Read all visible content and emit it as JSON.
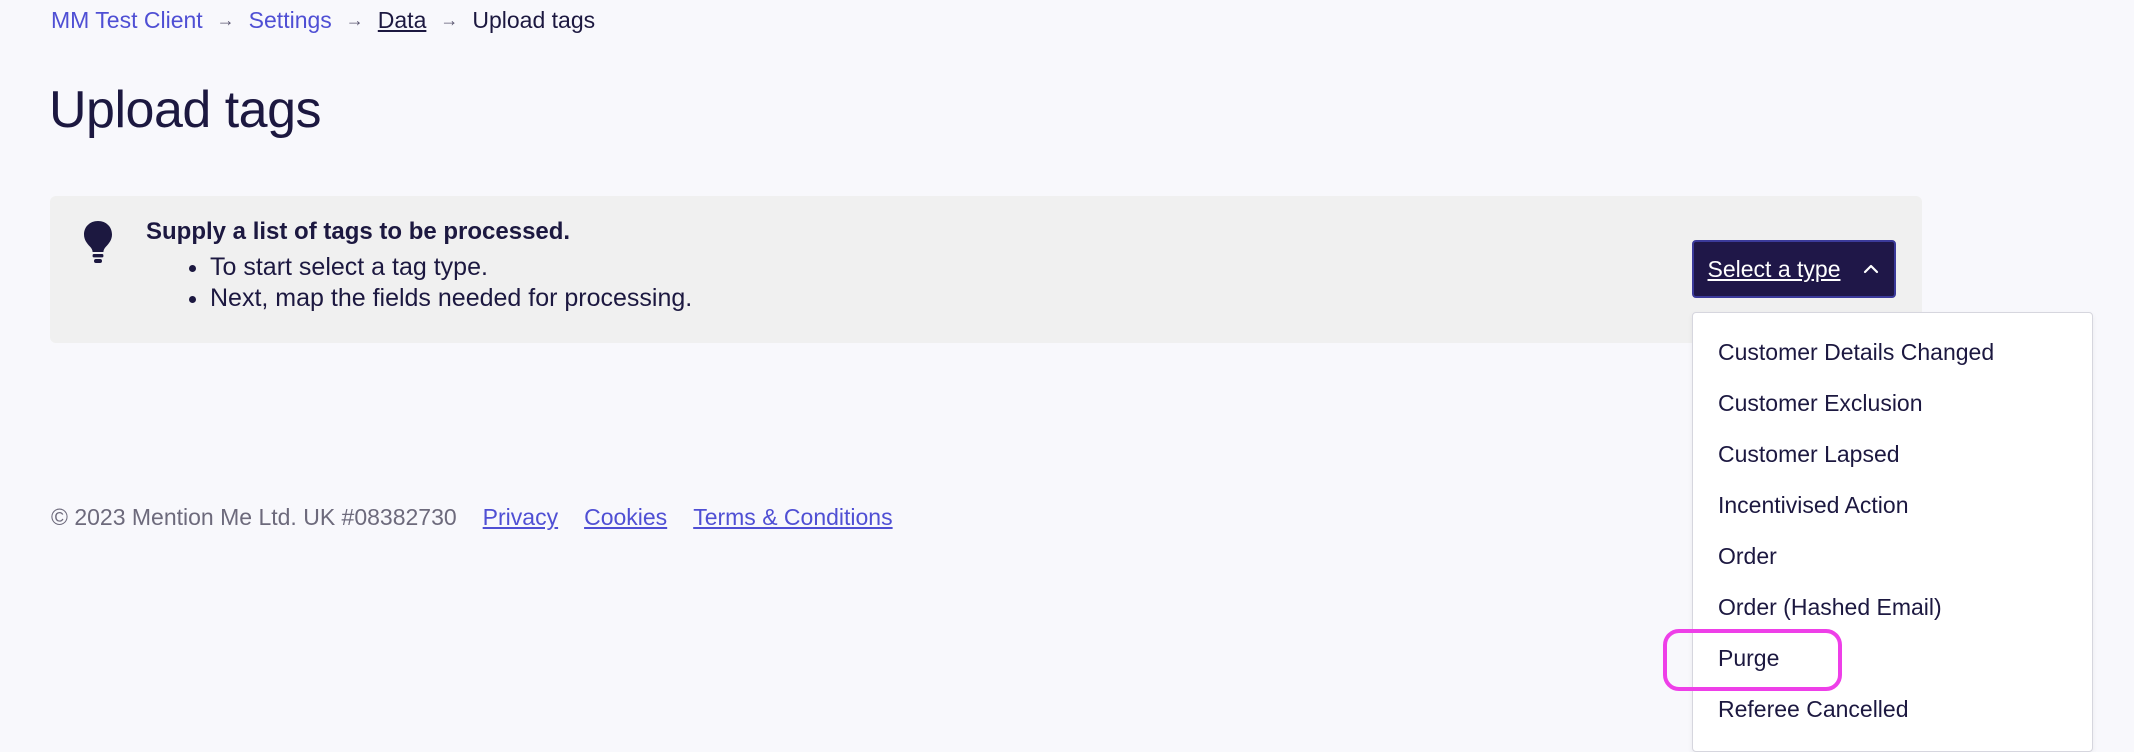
{
  "breadcrumb": {
    "items": [
      {
        "label": "MM Test Client"
      },
      {
        "label": "Settings"
      },
      {
        "label": "Data"
      },
      {
        "label": "Upload tags"
      }
    ],
    "separator_icon": "arrow-right-icon"
  },
  "page": {
    "title": "Upload tags"
  },
  "info": {
    "icon": "lightbulb-icon",
    "heading": "Supply a list of tags to be processed.",
    "bullets": [
      "To start select a tag type.",
      "Next, map the fields needed for processing."
    ]
  },
  "type_select": {
    "label": "Select a type",
    "icon": "chevron-up-icon",
    "expanded": true,
    "options": [
      "Customer Details Changed",
      "Customer Exclusion",
      "Customer Lapsed",
      "Incentivised Action",
      "Order",
      "Order (Hashed Email)",
      "Purge",
      "Referee Cancelled"
    ],
    "highlighted_option": "Purge"
  },
  "footer": {
    "copyright": "© 2023 Mention Me Ltd. UK #08382730",
    "links": [
      "Privacy",
      "Cookies",
      "Terms & Conditions"
    ]
  },
  "colors": {
    "background": "#f8f8fc",
    "link": "#4f4fd4",
    "text": "#1c1840",
    "button": "#1f1748",
    "panel": "#f0f0f0",
    "highlight": "#ee3fe8"
  }
}
